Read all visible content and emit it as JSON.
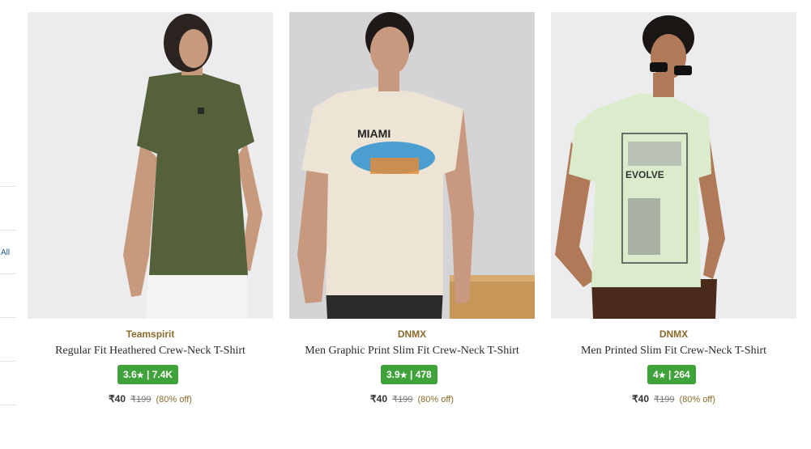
{
  "sidebar": {
    "link_label": "All"
  },
  "products": [
    {
      "brand": "Teamspirit",
      "title": "Regular Fit Heathered Crew-Neck T-Shirt",
      "rating": "3.6",
      "rating_count": "7.4K",
      "price": "₹40",
      "mrp": "₹199",
      "discount": "(80% off)",
      "image": {
        "bg": "#ececef",
        "shirt": "#55613a",
        "pants": "#f4f4f2"
      }
    },
    {
      "brand": "DNMX",
      "title": "Men Graphic Print Slim Fit Crew-Neck T-Shirt",
      "rating": "3.9",
      "rating_count": "478",
      "price": "₹40",
      "mrp": "₹199",
      "discount": "(80% off)",
      "image": {
        "bg": "#d4d4d6",
        "shirt": "#ede4d6",
        "pants": "#2b2b2b",
        "print_text": "MIAMI"
      }
    },
    {
      "brand": "DNMX",
      "title": "Men Printed Slim Fit Crew-Neck T-Shirt",
      "rating": "4",
      "rating_count": "264",
      "price": "₹40",
      "mrp": "₹199",
      "discount": "(80% off)",
      "image": {
        "bg": "#ececee",
        "shirt": "#dbeccc",
        "pants": "#4a2a1a",
        "print_text": "EVOLVE"
      }
    }
  ],
  "colors": {
    "brand": "#8a6a2c",
    "rating_bg": "#3fa23a"
  }
}
